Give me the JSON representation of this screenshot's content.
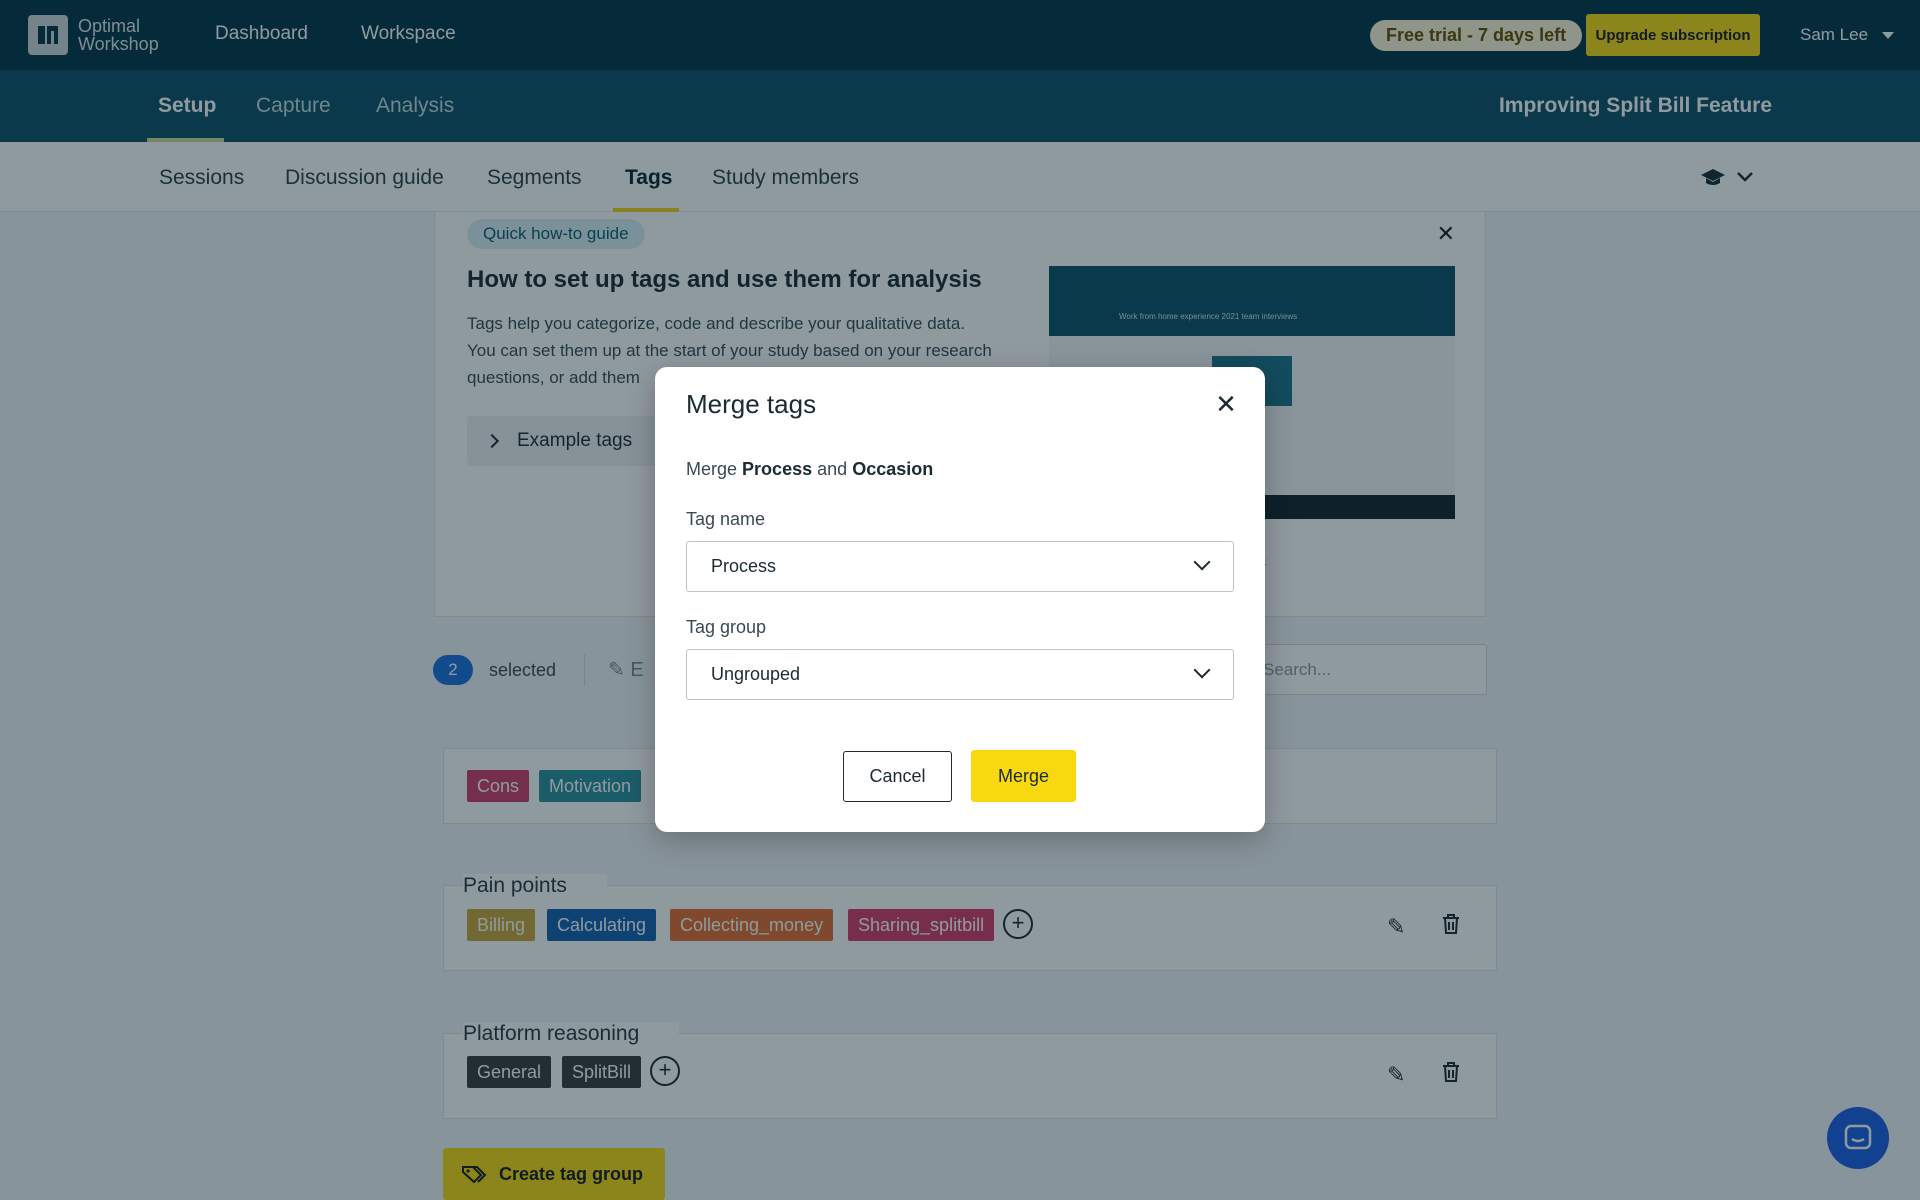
{
  "app": {
    "logo_line1": "Optimal",
    "logo_line2": "Workshop"
  },
  "topnav": {
    "links": [
      "Dashboard",
      "Workspace"
    ],
    "trial_badge": "Free trial - 7 days left",
    "upgrade_label": "Upgrade subscription",
    "user_name": "Sam Lee"
  },
  "main_tabs": {
    "items": [
      "Setup",
      "Capture",
      "Analysis"
    ],
    "active": "Setup",
    "study_title": "Improving Split Bill Feature"
  },
  "sub_tabs": {
    "items": [
      "Sessions",
      "Discussion guide",
      "Segments",
      "Tags",
      "Study members"
    ],
    "active": "Tags"
  },
  "guide": {
    "pill": "Quick how-to guide",
    "title": "How to set up tags and use them for analysis",
    "desc_line1": "Tags help you categorize, code and describe your qualitative data.",
    "desc_line2": "You can set them up at the start of your study based on your research",
    "desc_line3": "questions, or add them",
    "example_label": "Example tags",
    "video_link_fragment": "gs",
    "video_caption": "Work from home experience 2021 team interviews"
  },
  "toolbar": {
    "selected_count": "2",
    "selected_label": "selected",
    "edit_fragment": "E",
    "search_placeholder": "Search..."
  },
  "tag_groups": [
    {
      "title": "",
      "tags": [
        {
          "label": "Cons",
          "color": "#cf3d6b"
        },
        {
          "label": "Motivation",
          "color": "#2a8f9a"
        }
      ]
    },
    {
      "title": "Pain points",
      "tags": [
        {
          "label": "Billing",
          "color": "#c9a43a"
        },
        {
          "label": "Calculating",
          "color": "#1560b0"
        },
        {
          "label": "Collecting_money",
          "color": "#e36a2e"
        },
        {
          "label": "Sharing_splitbill",
          "color": "#d63b66"
        }
      ]
    },
    {
      "title": "Platform reasoning",
      "tags": [
        {
          "label": "General",
          "color": "#3b3b3b"
        },
        {
          "label": "SplitBill",
          "color": "#3b3b3b"
        }
      ]
    }
  ],
  "create_group_label": "Create tag group",
  "modal": {
    "title": "Merge tags",
    "desc_prefix": "Merge",
    "tag_a": "Process",
    "desc_and": "and",
    "tag_b": "Occasion",
    "tag_name_label": "Tag name",
    "tag_name_value": "Process",
    "tag_group_label": "Tag group",
    "tag_group_value": "Ungrouped",
    "cancel_label": "Cancel",
    "merge_label": "Merge"
  },
  "icons": {
    "close": "close-icon",
    "chevron": "chevron-down-icon",
    "edit": "pencil-icon",
    "delete": "trash-icon",
    "add": "plus-icon",
    "help": "graduation-cap-icon",
    "chat": "chat-icon"
  },
  "colors": {
    "topbar": "#04354a",
    "secondbar": "#0d4f66",
    "accent_yellow": "#f8d90f",
    "selected_badge": "#1b6fdc"
  }
}
